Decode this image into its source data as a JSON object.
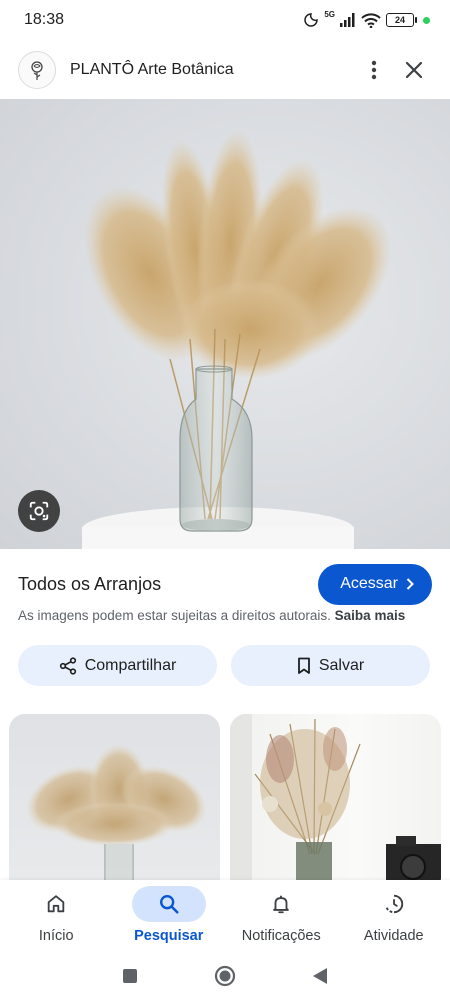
{
  "status_bar": {
    "time": "18:38",
    "network": "5G",
    "battery": "24",
    "icons": [
      "moon-icon",
      "signal-icon",
      "wifi-icon",
      "battery-icon"
    ]
  },
  "header": {
    "site_name": "PLANTÔ Arte Botânica",
    "menu_icon": "more-vert-icon",
    "close_icon": "close-icon"
  },
  "result": {
    "title": "Todos os Arranjos",
    "visit_label": "Acessar",
    "copyright_text": "As imagens podem estar sujeitas a direitos autorais.",
    "learn_more": "Saiba mais"
  },
  "actions": {
    "share_label": "Compartilhar",
    "save_label": "Salvar"
  },
  "bottom_nav": {
    "items": [
      {
        "label": "Início",
        "icon": "home-icon",
        "active": false
      },
      {
        "label": "Pesquisar",
        "icon": "search-icon",
        "active": true
      },
      {
        "label": "Notificações",
        "icon": "bell-icon",
        "active": false
      },
      {
        "label": "Atividade",
        "icon": "history-icon",
        "active": false
      }
    ]
  },
  "colors": {
    "accent": "#0b57d0",
    "pill_bg": "#e8f0fe",
    "nav_active_bg": "#d3e3fd"
  }
}
